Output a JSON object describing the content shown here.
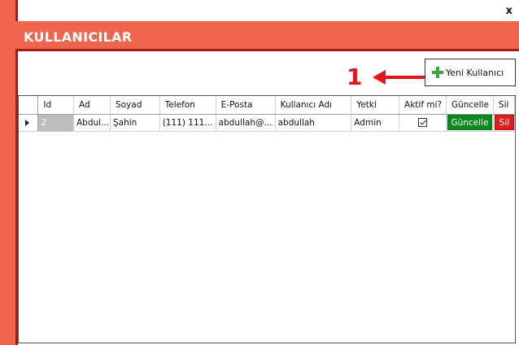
{
  "window": {
    "close_label": "x"
  },
  "header": {
    "title": "KULLANICILAR"
  },
  "annotation": {
    "number": "1"
  },
  "toolbar": {
    "new_user_label": "Yeni Kullanıcı"
  },
  "grid": {
    "columns": [
      "Id",
      "Ad",
      "Soyad",
      "Telefon",
      "E-Posta",
      "Kullanıcı Adı",
      "Yetki",
      "Aktif mi?",
      "Güncelle",
      "Sil"
    ],
    "rows": [
      {
        "id": "2",
        "ad": "Abdul...",
        "soyad": "Şahin",
        "telefon": "(111) 111...",
        "eposta": "abdullah@...",
        "kullanici_adi": "abdullah",
        "yetki": "Admin",
        "aktif": true,
        "guncelle_label": "Güncelle",
        "sil_label": "Sil"
      }
    ]
  },
  "colors": {
    "accent": "#f0654d",
    "accent_dark": "#a01e10",
    "update_button": "#0c8a1e",
    "delete_button": "#e31b1b",
    "annotation": "#e4141b",
    "plus_icon": "#3aa838"
  }
}
